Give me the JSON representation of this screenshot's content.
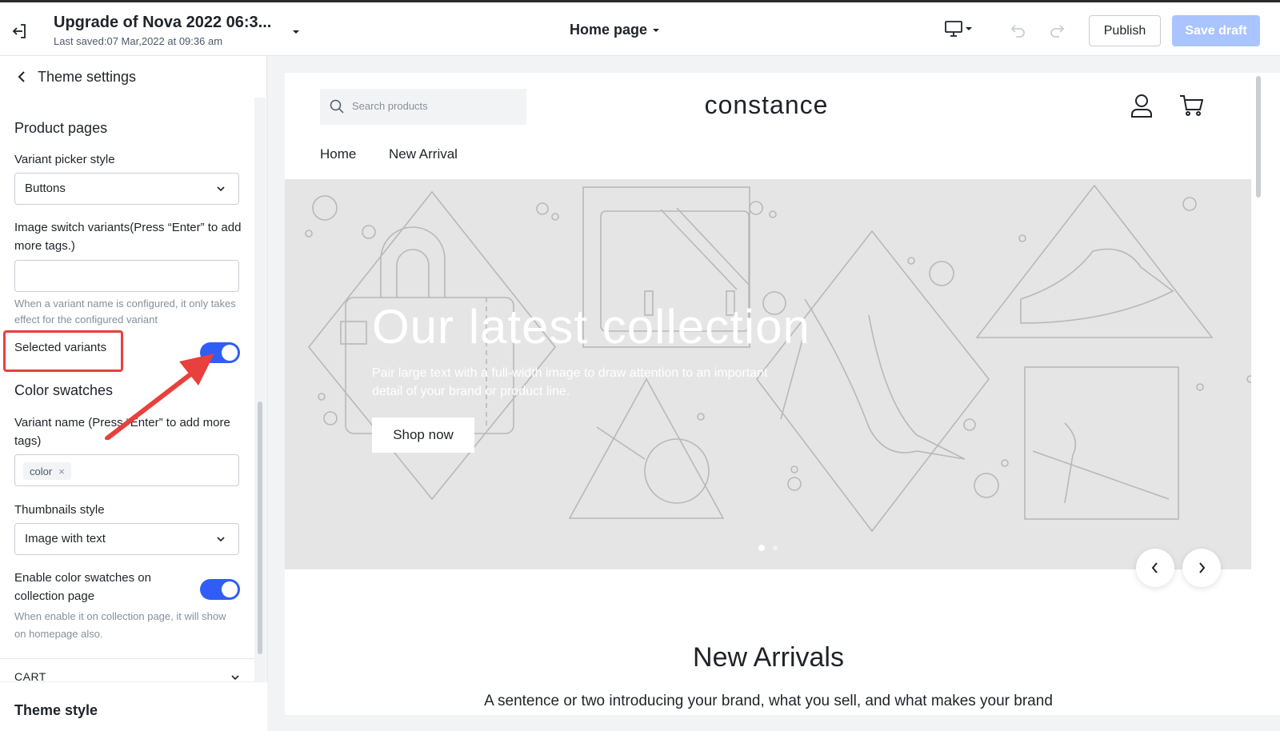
{
  "topbar": {
    "title": "Upgrade of Nova 2022 06:3...",
    "last_saved": "Last saved:07 Mar,2022 at 09:36 am",
    "page_selector": "Home page",
    "publish_label": "Publish",
    "save_draft_label": "Save draft"
  },
  "sidebar": {
    "header_title": "Theme settings",
    "product_pages_title": "Product pages",
    "variant_picker_label": "Variant picker style",
    "variant_picker_value": "Buttons",
    "image_switch_label": "Image switch variants(Press “Enter” to add more tags.)",
    "image_switch_value": "",
    "image_switch_hint": "When a variant name is configured, it only takes effect for the configured variant",
    "selected_variants_label": "Selected variants",
    "selected_variants_on": true,
    "color_swatches_title": "Color swatches",
    "variant_name_label": "Variant name (Press “Enter” to add more tags)",
    "variant_name_tags": [
      "color"
    ],
    "thumbnails_label": "Thumbnails style",
    "thumbnails_value": "Image with text",
    "enable_swatches_label": "Enable color swatches on collection page",
    "enable_swatches_on": true,
    "enable_swatches_hint": "When enable it on collection page, it will show on homepage also.",
    "cart_label": "CART",
    "theme_style_label": "Theme style"
  },
  "preview": {
    "search_placeholder": "Search products",
    "store_name": "constance",
    "nav": [
      "Home",
      "New Arrival"
    ],
    "hero_heading": "Our latest collection",
    "hero_subtext": "Pair large text with a full-width image to draw attention to an important detail of your brand or product line.",
    "shop_button": "Shop now",
    "slide_count": 2,
    "active_slide": 1,
    "section_title": "New Arrivals",
    "section_tagline": "A sentence or two introducing your brand, what you sell, and what makes your brand"
  },
  "colors": {
    "accent": "#2f5df6",
    "save_draft_bg": "#a9c4ff",
    "annotation": "#e8403d",
    "hero_bg": "#e5e5e5"
  }
}
